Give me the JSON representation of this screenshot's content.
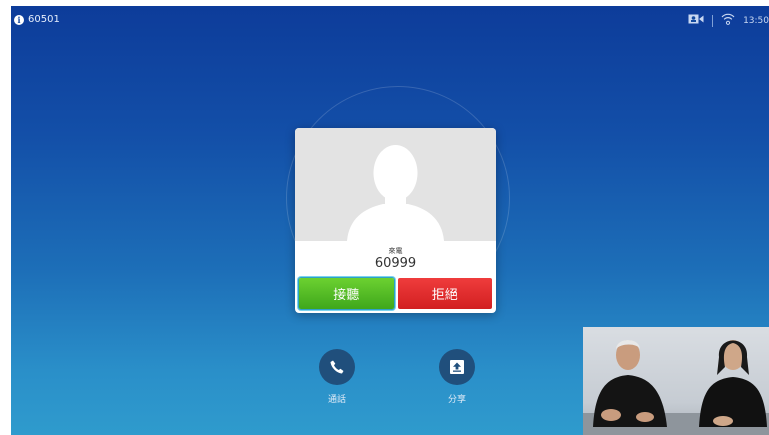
{
  "status_bar": {
    "extension": "60501",
    "info_icon": "i",
    "camera_icon": "camera-icon",
    "wifi_icon": "wifi-icon",
    "time": "13:50"
  },
  "call_card": {
    "avatar_icon": "person-silhouette-icon",
    "incoming_label": "來電",
    "caller_number": "60999",
    "accept_label": "接聽",
    "decline_label": "拒絕"
  },
  "quick_actions": [
    {
      "icon": "phone-icon",
      "label": "通話"
    },
    {
      "icon": "share-icon",
      "label": "分享"
    }
  ],
  "colors": {
    "accept": "#4db822",
    "decline": "#e02a2b",
    "background_top": "#0d3c9a",
    "background_bottom": "#2f9bcd"
  }
}
